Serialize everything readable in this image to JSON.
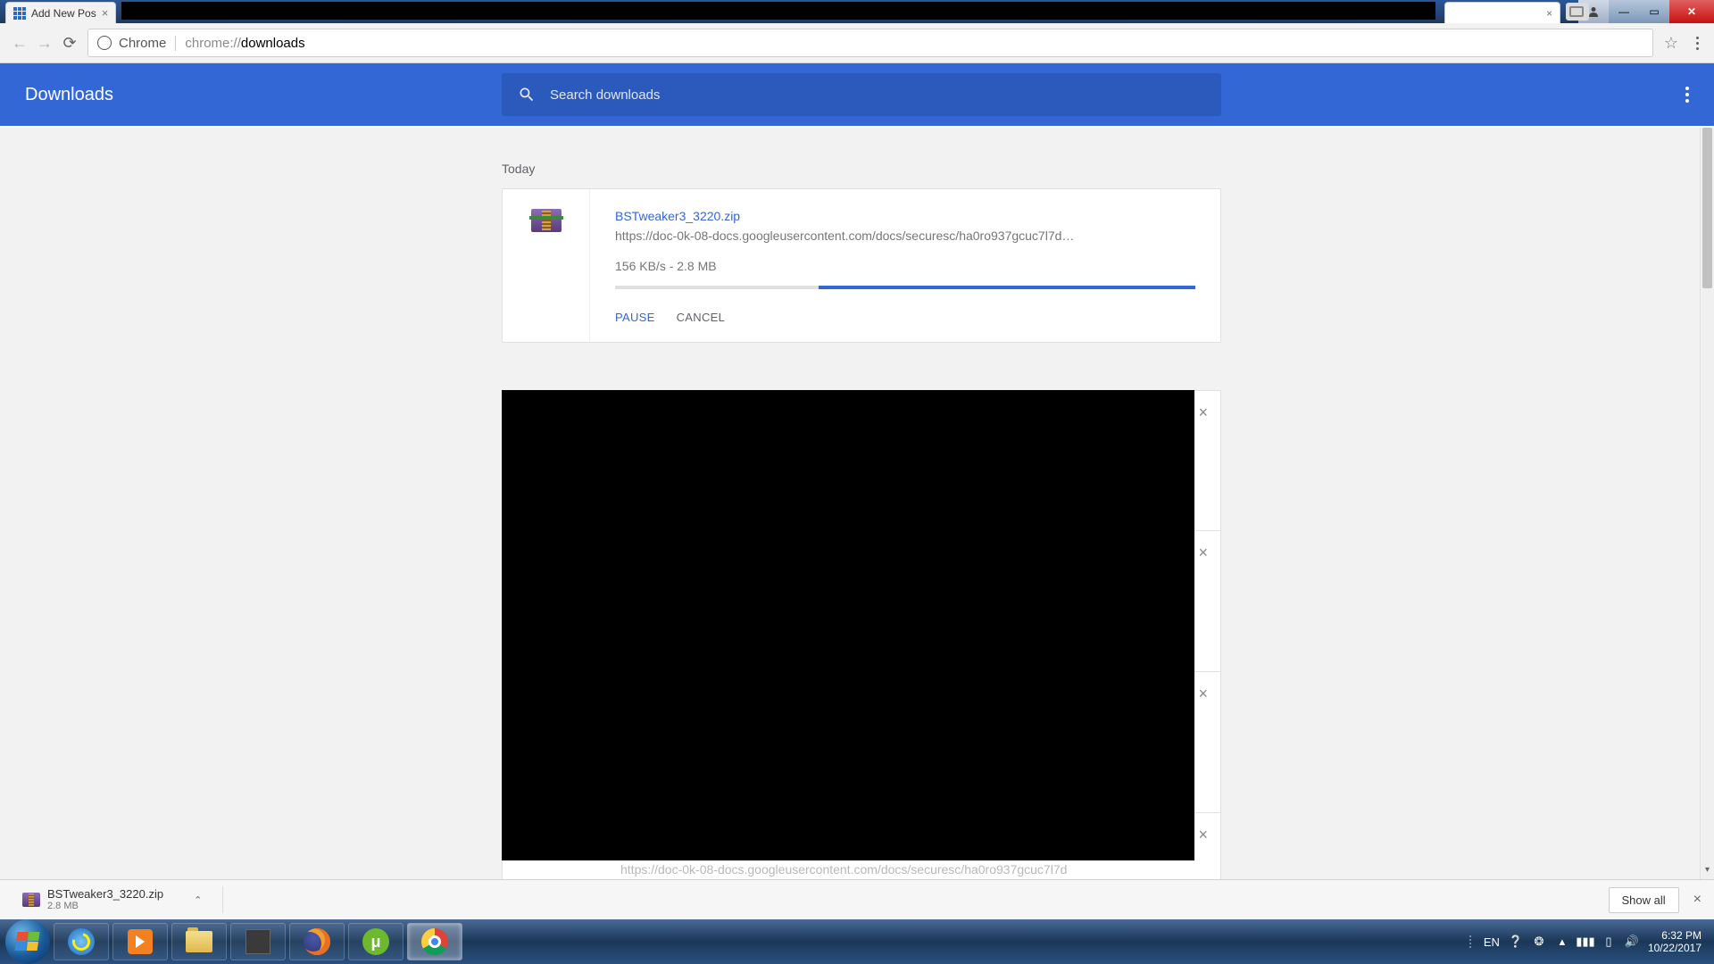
{
  "window": {
    "tab_title": "Add New Pos",
    "user_btn": "◩",
    "min": "—",
    "max": "▭",
    "close": "✕"
  },
  "omnibox": {
    "chrome_label": "Chrome",
    "url_prefix": "chrome://",
    "url_bold": "downloads"
  },
  "header": {
    "title": "Downloads",
    "search_placeholder": "Search downloads"
  },
  "section_label": "Today",
  "download": {
    "filename": "BSTweaker3_3220.zip",
    "url": "https://doc-0k-08-docs.googleusercontent.com/docs/securesc/ha0ro937gcuc7l7d…",
    "speed": "156 KB/s - 2.8 MB",
    "pause": "PAUSE",
    "cancel": "CANCEL",
    "progress_remaining_pct": 65
  },
  "peek_url": "https://doc-0k-08-docs.googleusercontent.com/docs/securesc/ha0ro937gcuc7l7d",
  "shelf": {
    "filename": "BSTweaker3_3220.zip",
    "size": "2.8 MB",
    "show_all": "Show all"
  },
  "tray": {
    "lang": "EN",
    "time": "6:32 PM",
    "date": "10/22/2017"
  }
}
